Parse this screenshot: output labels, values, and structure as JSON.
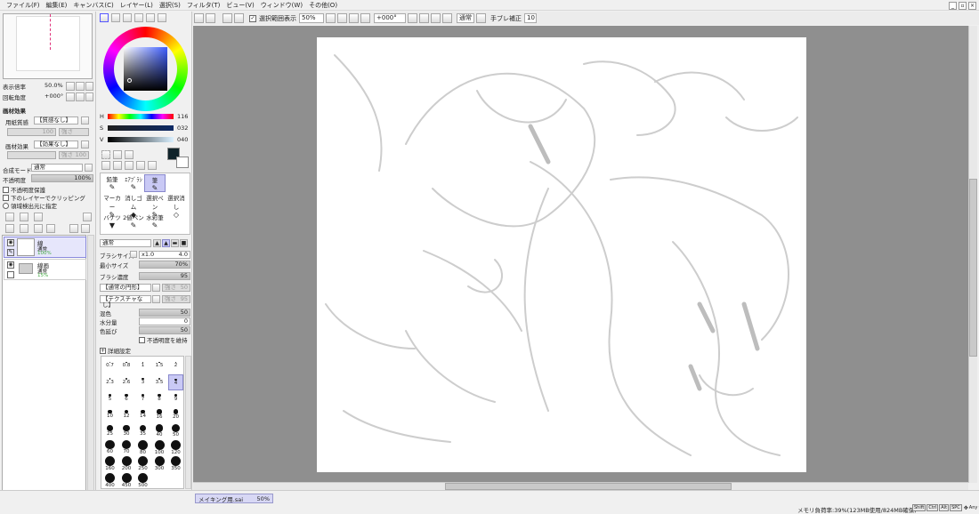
{
  "menu": [
    "ファイル(F)",
    "編集(E)",
    "キャンバス(C)",
    "レイヤー(L)",
    "選択(S)",
    "フィルタ(T)",
    "ビュー(V)",
    "ウィンドウ(W)",
    "その他(O)"
  ],
  "toolbar": {
    "show_selection_label": "選択範囲表示",
    "zoom_value": "50%",
    "angle_value": "+000°",
    "blend_mode": "通常",
    "stabilizer_label": "手ブレ補正",
    "stabilizer_value": "10"
  },
  "navigator": {
    "zoom_label": "表示倍率",
    "zoom_value": "50.0%",
    "rotate_label": "回転角度",
    "rotate_value": "+000°"
  },
  "paper_texture": {
    "section_title": "画材効果",
    "texture_label": "用紙質感",
    "texture_value": "【質感なし】",
    "effect_label": "画材効果",
    "effect_value": "【効果なし】",
    "v1": "100",
    "v2": "100",
    "f1": "強さ",
    "f2": "強さ"
  },
  "layer_props": {
    "blend_label": "合成モード",
    "blend_value": "通常",
    "opacity_label": "不透明度",
    "opacity_value": "100%",
    "opt1": "不透明度保護",
    "opt2": "下のレイヤーでクリッピング",
    "opt3": "領域検出元に指定"
  },
  "layers": [
    {
      "name": "線",
      "mode": "通常",
      "opacity": "100%"
    },
    {
      "name": "線画",
      "mode": "通常",
      "opacity": "15%"
    }
  ],
  "color": {
    "h_label": "H",
    "h_value": "116",
    "s_label": "S",
    "s_value": "032",
    "v_label": "V",
    "v_value": "040",
    "fg": "#10232a",
    "bg": "#ffffff"
  },
  "tools": [
    {
      "label": "鉛筆"
    },
    {
      "label": "ｴｱﾌﾞﾗｼ"
    },
    {
      "label": "筆"
    },
    {
      "label": ""
    },
    {
      "label": "マーカー"
    },
    {
      "label": "消しゴム"
    },
    {
      "label": "選択ペン"
    },
    {
      "label": "選択消し"
    },
    {
      "label": "バケツ"
    },
    {
      "label": "2値ペン"
    },
    {
      "label": "水彩筆"
    },
    {
      "label": ""
    }
  ],
  "brush": {
    "mode": "通常",
    "size_label": "ブラシサイズ",
    "size_mult": "x1.0",
    "size_value": "4.0",
    "min_size_label": "最小サイズ",
    "min_size_value": "70%",
    "density_label": "ブラシ濃度",
    "density_value": "95",
    "shape": "【通常の円形】",
    "texture": "【テクスチャなし】",
    "shape_strength": "強さ",
    "shape_v": "50",
    "tex_strength": "強さ",
    "tex_v": "95",
    "mix_label": "混色",
    "mix_value": "50",
    "water_label": "水分量",
    "water_value": "0",
    "persist_label": "色延び",
    "persist_value": "50",
    "keep_opacity": "不透明度を維持",
    "detail_label": "詳細設定"
  },
  "brush_sizes": [
    "0.7",
    "0.8",
    "1",
    "1.5",
    "2",
    "2.3",
    "2.6",
    "3",
    "3.5",
    "4",
    "5",
    "6",
    "7",
    "8",
    "9",
    "10",
    "12",
    "14",
    "16",
    "20",
    "25",
    "30",
    "35",
    "40",
    "50",
    "60",
    "70",
    "80",
    "100",
    "120",
    "160",
    "200",
    "250",
    "300",
    "350",
    "400",
    "450",
    "500"
  ],
  "document": {
    "tab_name": "メイキング用.sai",
    "tab_zoom": "50%"
  },
  "status": {
    "memory": "メモリ負荷率:39%(123MB使用/824MB確保)",
    "keys": [
      "Shift",
      "Ctrl",
      "Alt",
      "SPC"
    ],
    "any": "Any"
  }
}
